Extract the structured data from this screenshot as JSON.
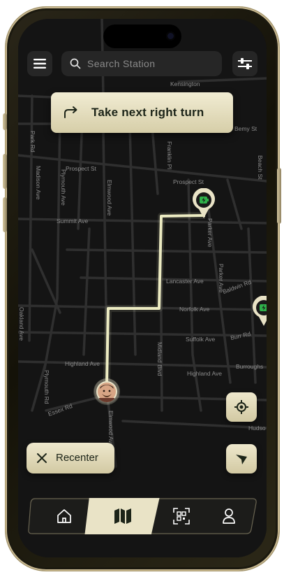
{
  "header": {
    "menu_icon": "hamburger-menu-icon",
    "search_placeholder": "Search Station",
    "filter_icon": "sliders-filter-icon"
  },
  "instruction": {
    "icon": "turn-right-arrow-icon",
    "text": "Take next right turn"
  },
  "map": {
    "streets": {
      "park_rd": "Park Rd",
      "madison": "Madison Ave",
      "plymouth_ave": "Plymouth Ave",
      "elmwood_ave_top": "Elmwood Ave",
      "franklin": "Franklin Pl",
      "prospect_st_1": "Prospect St",
      "prospect_st_2": "Prospect St",
      "summit_ave": "Summit Ave",
      "parker_ave": "Parker Ave",
      "parker_ave_2": "Parker Ave",
      "beach": "Beach St",
      "bemy": "Bemy St",
      "kensington": "Kensington",
      "lancaster": "Lancaster Ave",
      "baldwin": "Baldwin Rd",
      "norfolk": "Norfolk Ave",
      "midland": "Midland Blvd",
      "suffolk": "Suffolk Ave",
      "burr": "Burr Rd",
      "oakland": "Oakland Ave",
      "highland_1": "Highland Ave",
      "highland_2": "Highland Ave",
      "burroughs": "Burroughs",
      "plymouth_rd": "Plymouth Rd",
      "essex": "Essex Rd",
      "elmwood_bottom": "Elmwood Ave",
      "hudson": "Hudso"
    },
    "stations": [
      "charging-station-pin",
      "charging-station-pin"
    ]
  },
  "controls": {
    "recenter_label": "Recenter",
    "recenter_icon": "close-x-icon",
    "locate_icon": "locate-crosshair-icon",
    "compass_icon": "navigation-arrow-icon"
  },
  "colors": {
    "accent": "#e9e3c6",
    "route": "#ecebc2",
    "station_green": "#2fb14a",
    "map_bg": "#121212"
  },
  "navbar": {
    "items": [
      {
        "icon": "home-icon",
        "active": false
      },
      {
        "icon": "map-icon",
        "active": true
      },
      {
        "icon": "qr-scan-icon",
        "active": false
      },
      {
        "icon": "profile-icon",
        "active": false
      }
    ]
  }
}
